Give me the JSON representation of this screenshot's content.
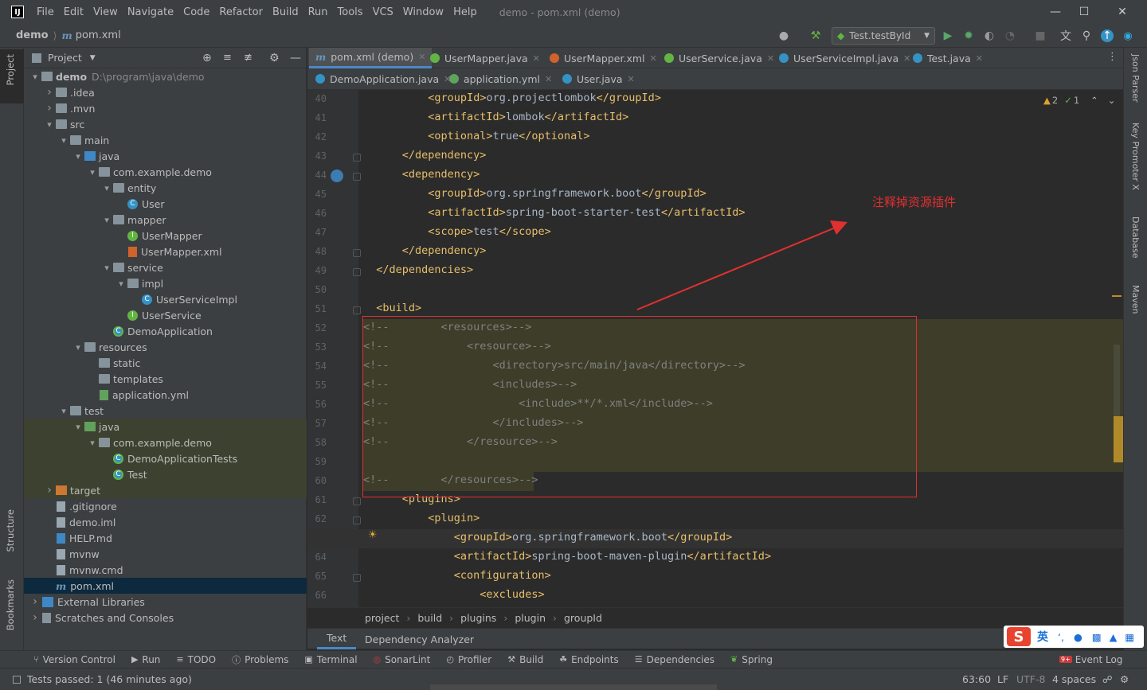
{
  "menubar": {
    "items": [
      "File",
      "Edit",
      "View",
      "Navigate",
      "Code",
      "Refactor",
      "Build",
      "Run",
      "Tools",
      "VCS",
      "Window",
      "Help"
    ],
    "window_title": "demo - pom.xml (demo)"
  },
  "navbar": {
    "project": "demo",
    "file": "pom.xml",
    "run_config": "Test.testById"
  },
  "left_strip": {
    "project": "Project",
    "structure": "Structure",
    "bookmarks": "Bookmarks"
  },
  "right_strip": {
    "json_parser": "Json Parser",
    "key_promoter": "Key Promoter X",
    "database": "Database",
    "maven": "Maven"
  },
  "project_panel": {
    "title": "Project",
    "tree": [
      {
        "depth": 0,
        "arrow": "v",
        "icon": "folder",
        "label": "demo",
        "extra": "D:\\program\\java\\demo"
      },
      {
        "depth": 1,
        "arrow": ">",
        "icon": "folder",
        "label": ".idea"
      },
      {
        "depth": 1,
        "arrow": ">",
        "icon": "folder",
        "label": ".mvn"
      },
      {
        "depth": 1,
        "arrow": "v",
        "icon": "folder",
        "label": "src"
      },
      {
        "depth": 2,
        "arrow": "v",
        "icon": "folder",
        "label": "main"
      },
      {
        "depth": 3,
        "arrow": "v",
        "icon": "folder-blue",
        "label": "java"
      },
      {
        "depth": 4,
        "arrow": "v",
        "icon": "package",
        "label": "com.example.demo"
      },
      {
        "depth": 5,
        "arrow": "v",
        "icon": "package",
        "label": "entity"
      },
      {
        "depth": 6,
        "arrow": "",
        "icon": "class",
        "label": "User"
      },
      {
        "depth": 5,
        "arrow": "v",
        "icon": "package",
        "label": "mapper"
      },
      {
        "depth": 6,
        "arrow": "",
        "icon": "interface",
        "label": "UserMapper"
      },
      {
        "depth": 6,
        "arrow": "",
        "icon": "xml",
        "label": "UserMapper.xml"
      },
      {
        "depth": 5,
        "arrow": "v",
        "icon": "package",
        "label": "service"
      },
      {
        "depth": 6,
        "arrow": "v",
        "icon": "package",
        "label": "impl"
      },
      {
        "depth": 7,
        "arrow": "",
        "icon": "class",
        "label": "UserServiceImpl"
      },
      {
        "depth": 6,
        "arrow": "",
        "icon": "interface",
        "label": "UserService"
      },
      {
        "depth": 5,
        "arrow": "",
        "icon": "spring",
        "label": "DemoApplication"
      },
      {
        "depth": 3,
        "arrow": "v",
        "icon": "folder-res",
        "label": "resources"
      },
      {
        "depth": 4,
        "arrow": "",
        "icon": "folder",
        "label": "static"
      },
      {
        "depth": 4,
        "arrow": "",
        "icon": "folder",
        "label": "templates"
      },
      {
        "depth": 4,
        "arrow": "",
        "icon": "yml",
        "label": "application.yml"
      },
      {
        "depth": 2,
        "arrow": "v",
        "icon": "folder",
        "label": "test"
      },
      {
        "depth": 3,
        "arrow": "v",
        "icon": "folder-green",
        "label": "java"
      },
      {
        "depth": 4,
        "arrow": "v",
        "icon": "package",
        "label": "com.example.demo"
      },
      {
        "depth": 5,
        "arrow": "",
        "icon": "spring",
        "label": "DemoApplicationTests"
      },
      {
        "depth": 5,
        "arrow": "",
        "icon": "spring",
        "label": "Test"
      },
      {
        "depth": 1,
        "arrow": ">",
        "icon": "folder-orange",
        "label": "target"
      },
      {
        "depth": 1,
        "arrow": "",
        "icon": "file",
        "label": ".gitignore"
      },
      {
        "depth": 1,
        "arrow": "",
        "icon": "file",
        "label": "demo.iml"
      },
      {
        "depth": 1,
        "arrow": "",
        "icon": "md",
        "label": "HELP.md"
      },
      {
        "depth": 1,
        "arrow": "",
        "icon": "file",
        "label": "mvnw"
      },
      {
        "depth": 1,
        "arrow": "",
        "icon": "file",
        "label": "mvnw.cmd"
      },
      {
        "depth": 1,
        "arrow": "",
        "icon": "maven",
        "label": "pom.xml"
      },
      {
        "depth": 0,
        "arrow": ">",
        "icon": "libs",
        "label": "External Libraries"
      },
      {
        "depth": 0,
        "arrow": ">",
        "icon": "scratch",
        "label": "Scratches and Consoles"
      }
    ]
  },
  "tabs_row1": [
    {
      "label": "pom.xml (demo)",
      "icon": "maven",
      "active": true
    },
    {
      "label": "UserMapper.java",
      "icon": "interface"
    },
    {
      "label": "UserMapper.xml",
      "icon": "xml"
    },
    {
      "label": "UserService.java",
      "icon": "interface"
    },
    {
      "label": "UserServiceImpl.java",
      "icon": "class"
    },
    {
      "label": "Test.java",
      "icon": "spring"
    }
  ],
  "tabs_row2": [
    {
      "label": "DemoApplication.java",
      "icon": "spring"
    },
    {
      "label": "application.yml",
      "icon": "yml"
    },
    {
      "label": "User.java",
      "icon": "class"
    }
  ],
  "editor": {
    "inspections": {
      "warnings": "2",
      "weak": "1"
    },
    "annotation": "注释掉资源插件",
    "lines": [
      {
        "n": "40",
        "code": [
          [
            "  ",
            "tx"
          ],
          [
            "        <",
            "tg"
          ],
          [
            "groupId",
            "tg"
          ],
          [
            ">",
            "tg"
          ],
          [
            "org.projectlombok",
            "tx"
          ],
          [
            "</",
            "tg"
          ],
          [
            "groupId",
            "tg"
          ],
          [
            ">",
            "tg"
          ]
        ]
      },
      {
        "n": "41",
        "code": [
          [
            "          <artifactId>",
            "tg"
          ],
          [
            "lombok",
            "tx"
          ],
          [
            "</artifactId>",
            "tg"
          ]
        ]
      },
      {
        "n": "42",
        "code": [
          [
            "          <optional>",
            "tg"
          ],
          [
            "true",
            "tx"
          ],
          [
            "</optional>",
            "tg"
          ]
        ]
      },
      {
        "n": "43",
        "code": [
          [
            "      </dependency>",
            "tg"
          ]
        ]
      },
      {
        "n": "44",
        "code": [
          [
            "      <dependency>",
            "tg"
          ]
        ]
      },
      {
        "n": "45",
        "code": [
          [
            "          <groupId>",
            "tg"
          ],
          [
            "org.springframework.boot",
            "tx"
          ],
          [
            "</groupId>",
            "tg"
          ]
        ]
      },
      {
        "n": "46",
        "code": [
          [
            "          <artifactId>",
            "tg"
          ],
          [
            "spring-boot-starter-test",
            "tx"
          ],
          [
            "</artifactId>",
            "tg"
          ]
        ]
      },
      {
        "n": "47",
        "code": [
          [
            "          <scope>",
            "tg"
          ],
          [
            "test",
            "tx"
          ],
          [
            "</scope>",
            "tg"
          ]
        ]
      },
      {
        "n": "48",
        "code": [
          [
            "      </dependency>",
            "tg"
          ]
        ]
      },
      {
        "n": "49",
        "code": [
          [
            "  </dependencies>",
            "tg"
          ]
        ]
      },
      {
        "n": "50",
        "code": [
          [
            "",
            "tx"
          ]
        ]
      },
      {
        "n": "51",
        "code": [
          [
            "  <build>",
            "tg"
          ]
        ]
      },
      {
        "n": "52",
        "code": [
          [
            "<!--        <resources>-->",
            "cm"
          ]
        ]
      },
      {
        "n": "53",
        "code": [
          [
            "<!--            <resource>-->",
            "cm"
          ]
        ]
      },
      {
        "n": "54",
        "code": [
          [
            "<!--                <directory>src/main/java</directory>-->",
            "cm"
          ]
        ]
      },
      {
        "n": "55",
        "code": [
          [
            "<!--                <includes>-->",
            "cm"
          ]
        ]
      },
      {
        "n": "56",
        "code": [
          [
            "<!--                    <include>**/*.xml</include>-->",
            "cm"
          ]
        ]
      },
      {
        "n": "57",
        "code": [
          [
            "<!--                </includes>-->",
            "cm"
          ]
        ]
      },
      {
        "n": "58",
        "code": [
          [
            "<!--            </resource>-->",
            "cm"
          ]
        ]
      },
      {
        "n": "59",
        "code": [
          [
            "",
            "cm"
          ]
        ]
      },
      {
        "n": "60",
        "code": [
          [
            "<!--        </resources>-->",
            "cm"
          ]
        ]
      },
      {
        "n": "61",
        "code": [
          [
            "      <plugins>",
            "tg"
          ]
        ]
      },
      {
        "n": "62",
        "code": [
          [
            "          <plugin>",
            "tg"
          ]
        ]
      },
      {
        "n": "63",
        "code": [
          [
            "              <groupId>",
            "tg"
          ],
          [
            "org.springframework.boot",
            "tx"
          ],
          [
            "</groupId>",
            "tg"
          ]
        ]
      },
      {
        "n": "64",
        "code": [
          [
            "              <artifactId>",
            "tg"
          ],
          [
            "spring-boot-maven-plugin",
            "tx"
          ],
          [
            "</artifactId>",
            "tg"
          ]
        ]
      },
      {
        "n": "65",
        "code": [
          [
            "              <configuration>",
            "tg"
          ]
        ]
      },
      {
        "n": "66",
        "code": [
          [
            "                  <excludes>",
            "tg"
          ]
        ]
      }
    ]
  },
  "breadcrumb": [
    "project",
    "build",
    "plugins",
    "plugin",
    "groupId"
  ],
  "bottom_tabs": [
    "Text",
    "Dependency Analyzer"
  ],
  "tool_windows": [
    "Version Control",
    "Run",
    "TODO",
    "Problems",
    "Terminal",
    "SonarLint",
    "Profiler",
    "Build",
    "Endpoints",
    "Dependencies",
    "Spring"
  ],
  "event_log": "Event Log",
  "event_count": "9+",
  "ime": {
    "lang": "英"
  },
  "status": {
    "message": "Tests passed: 1 (46 minutes ago)",
    "position": "63:60",
    "line_sep": "LF",
    "encoding": "UTF-8",
    "indent": "4 spaces"
  }
}
